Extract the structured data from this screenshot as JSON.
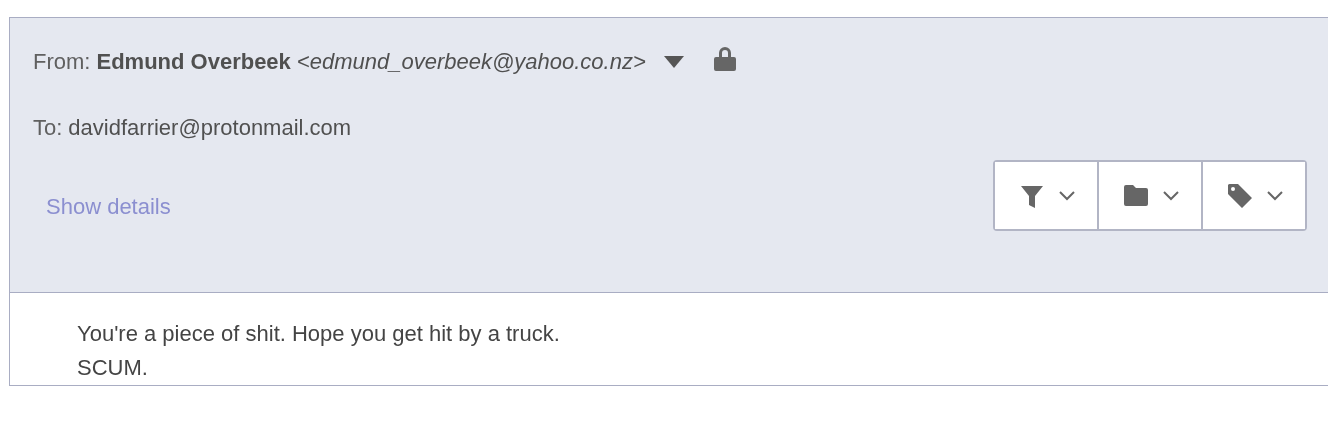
{
  "header": {
    "from_label": "From:",
    "sender_name": "Edmund Overbeek",
    "sender_email": "<edmund_overbeek@yahoo.co.nz>",
    "to_label": "To:",
    "recipient": "davidfarrier@protonmail.com",
    "details_link": "Show details"
  },
  "actions": [
    {
      "kind": "filter"
    },
    {
      "kind": "folder"
    },
    {
      "kind": "tag"
    }
  ],
  "body": [
    "You're a piece of shit. Hope you get hit by a truck.",
    "SCUM."
  ]
}
